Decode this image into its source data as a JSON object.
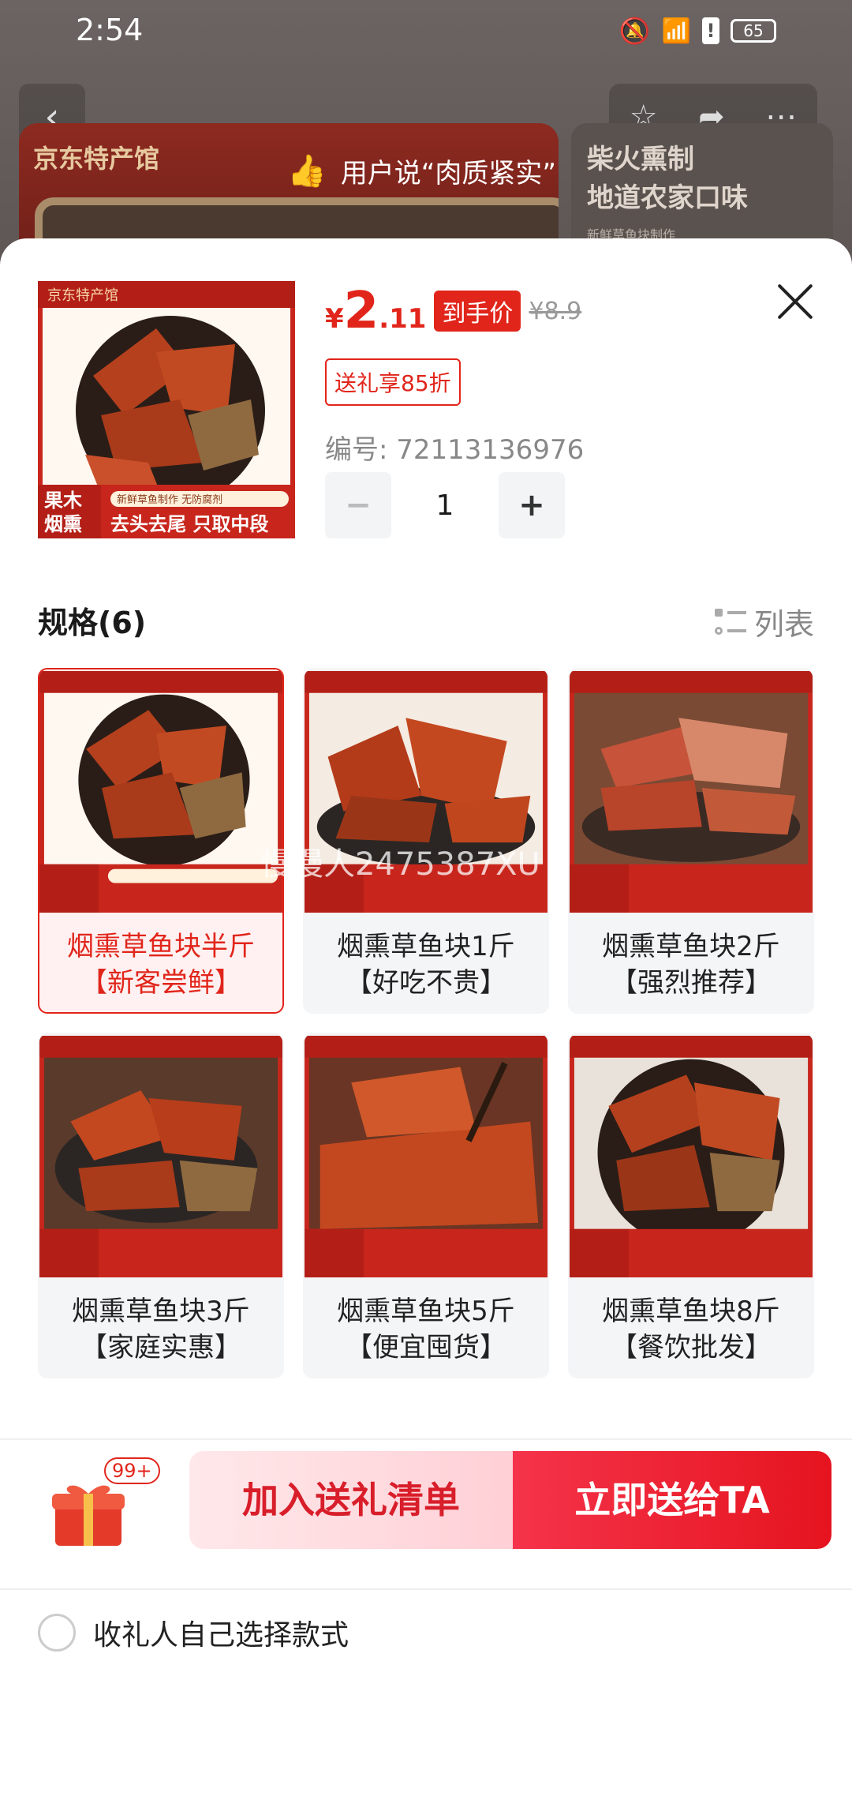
{
  "status": {
    "time": "2:54",
    "battery": "65"
  },
  "background": {
    "shop_logo": "京东特产馆",
    "praise_text": "用户说“肉质紧实”",
    "side_line1": "柴火熏制",
    "side_line2": "地道农家口味",
    "side_small": "新鲜草鱼块制作"
  },
  "product": {
    "price_yen": "¥",
    "price_int": "2",
    "price_dec": ".11",
    "price_tag": "到手价",
    "price_old": "¥8.9",
    "gift_discount": "送礼享85折",
    "sku_number": "编号: 72113136976",
    "quantity": "1",
    "minus": "−",
    "plus": "+"
  },
  "image_text": {
    "logo": "京东特产馆",
    "wood_top": "果木",
    "wood_bottom": "烟熏",
    "fresh": "新鲜草鱼制作 无防腐剂",
    "cut": "去头去尾 只取中段"
  },
  "specs": {
    "title": "规格(6)",
    "list_label": "列表",
    "items": [
      {
        "name": "烟熏草鱼块半斤",
        "sub": "【新客尝鲜】"
      },
      {
        "name": "烟熏草鱼块1斤",
        "sub": "【好吃不贵】"
      },
      {
        "name": "烟熏草鱼块2斤",
        "sub": "【强烈推荐】"
      },
      {
        "name": "烟熏草鱼块3斤",
        "sub": "【家庭实惠】"
      },
      {
        "name": "烟熏草鱼块5斤",
        "sub": "【便宜囤货】"
      },
      {
        "name": "烟熏草鱼块8斤",
        "sub": "【餐饮批发】"
      }
    ]
  },
  "watermark": "慢慢人2475387XU",
  "receiver_option": "收礼人自己选择款式",
  "bottom": {
    "badge": "99+",
    "add_label": "加入送礼清单",
    "send_label": "立即送给TA"
  },
  "colors": {
    "accent": "#e1251b",
    "brand_dark": "#8d2a20"
  }
}
